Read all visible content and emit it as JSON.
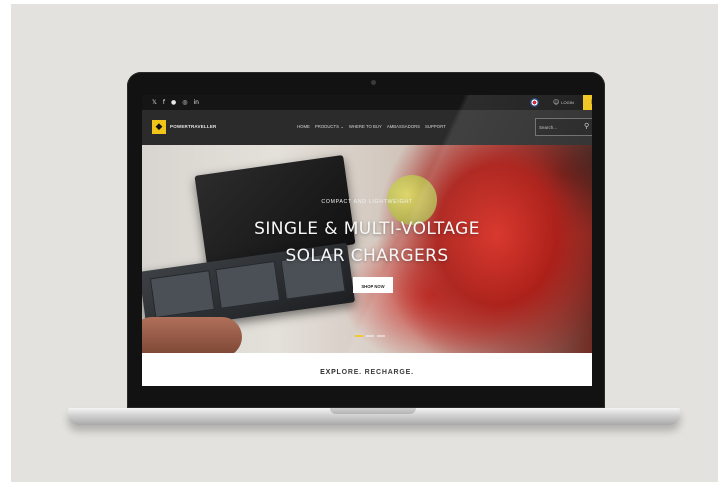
{
  "topbar": {
    "social": [
      "𝕏",
      "f",
      "●",
      "◎",
      "in"
    ],
    "login_label": "LOGIN",
    "login_icon": "user-icon",
    "cart_icon": "cart-icon"
  },
  "brand": {
    "name": "POWERTRAVELLER",
    "accent": "#f0c419"
  },
  "nav": {
    "items": [
      "HOME",
      "PRODUCTS ⌄",
      "WHERE TO BUY",
      "AMBASSADORS",
      "SUPPORT"
    ]
  },
  "search": {
    "placeholder": "Search..."
  },
  "hero": {
    "kicker": "COMPACT AND LIGHTWEIGHT",
    "title_line1": "SINGLE & MULTI-VOLTAGE",
    "title_line2": "SOLAR CHARGERS",
    "cta": "SHOP NOW",
    "slides_total": 3,
    "slide_active": 1
  },
  "tagline": "EXPLORE. RECHARGE."
}
